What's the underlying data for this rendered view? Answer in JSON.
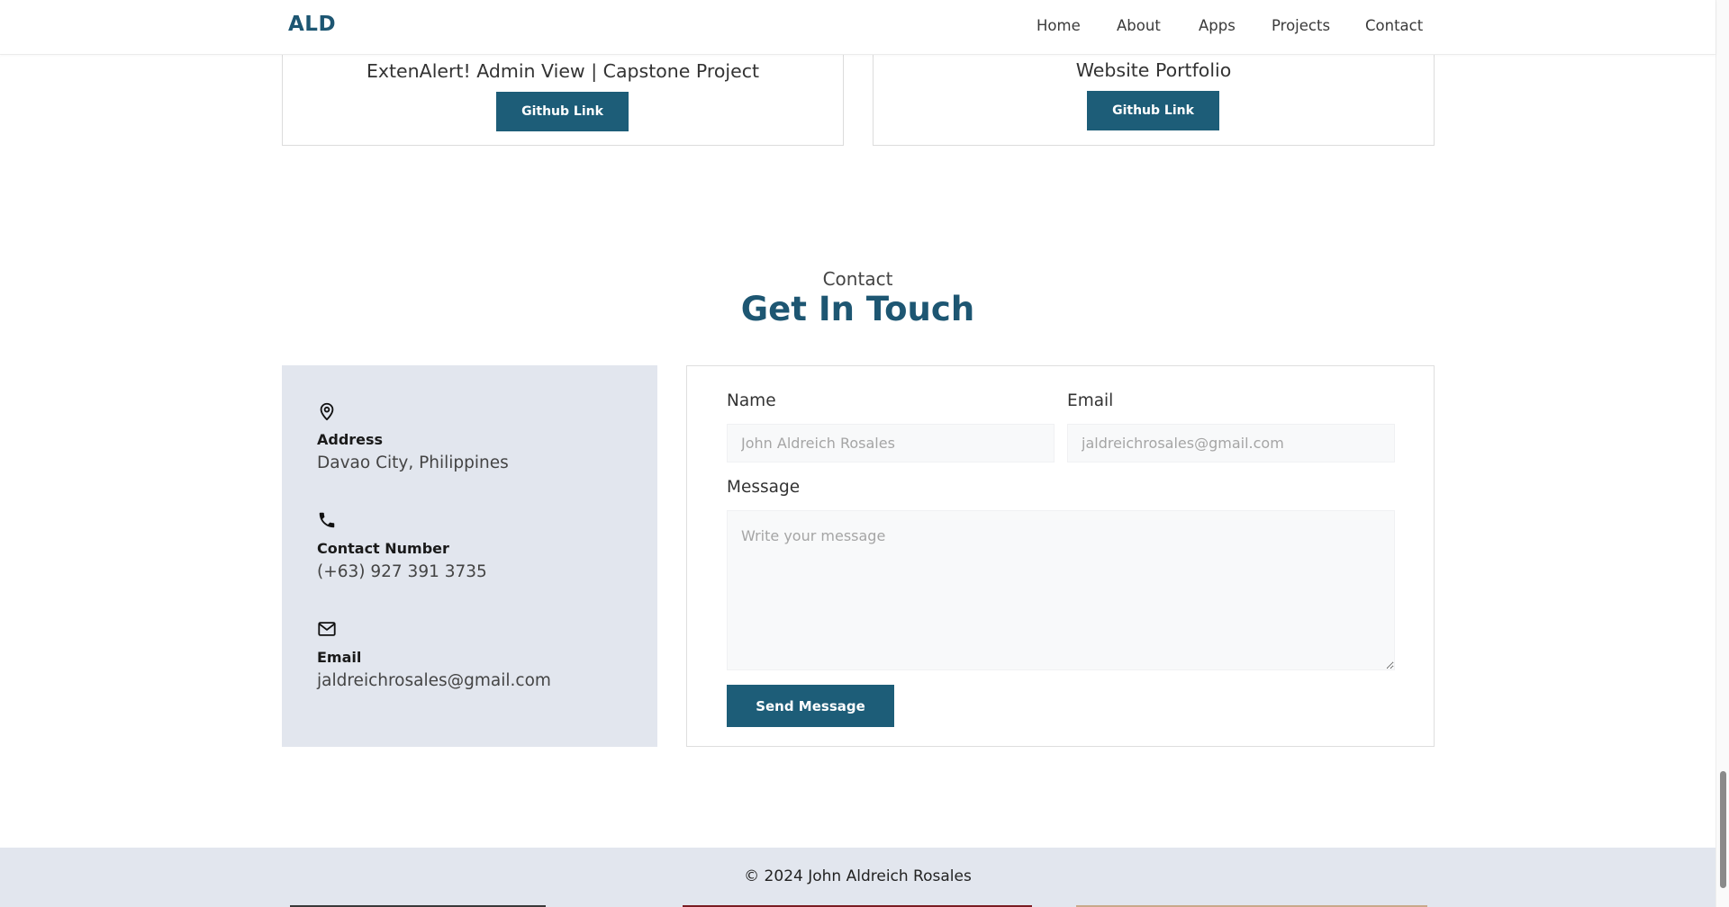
{
  "header": {
    "logo": "ALD",
    "nav": [
      "Home",
      "About",
      "Apps",
      "Projects",
      "Contact"
    ]
  },
  "projects": [
    {
      "title": "ExtenAlert! Admin View | Capstone Project",
      "button": "Github Link"
    },
    {
      "title": "Website Portfolio",
      "button": "Github Link"
    }
  ],
  "contact": {
    "subtitle": "Contact",
    "title": "Get In Touch",
    "info": [
      {
        "icon": "location-pin-icon",
        "label": "Address",
        "value": "Davao City, Philippines"
      },
      {
        "icon": "phone-icon",
        "label": "Contact Number",
        "value": "(+63) 927 391 3735"
      },
      {
        "icon": "mail-icon",
        "label": "Email",
        "value": "jaldreichrosales@gmail.com"
      }
    ],
    "form": {
      "name_label": "Name",
      "name_placeholder": "John Aldreich Rosales",
      "email_label": "Email",
      "email_placeholder": "jaldreichrosales@gmail.com",
      "message_label": "Message",
      "message_placeholder": "Write your message",
      "submit": "Send Message"
    }
  },
  "footer": {
    "copyright": "© 2024 John Aldreich Rosales"
  },
  "colors": {
    "brand": "#1d5672",
    "button": "#1d5d78",
    "panel": "#e2e6ee"
  }
}
